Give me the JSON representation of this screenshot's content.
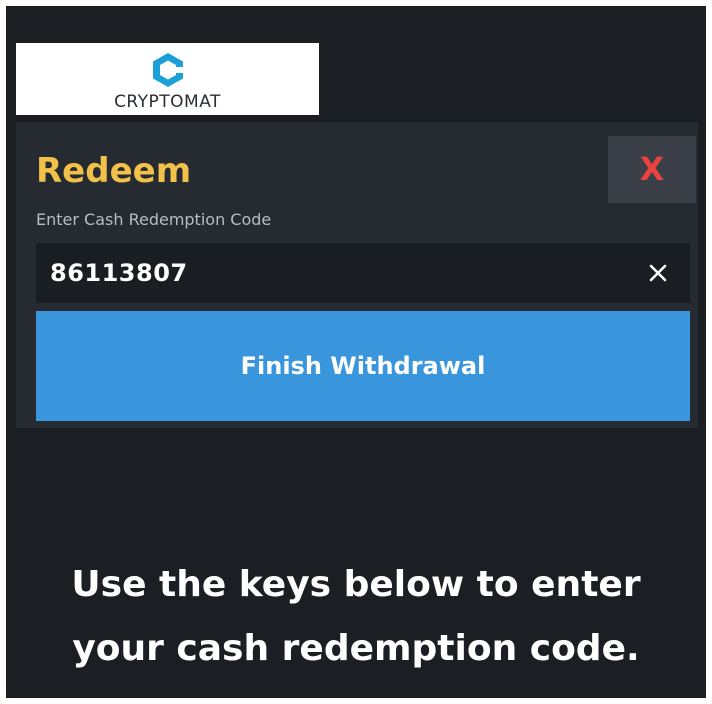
{
  "logo": {
    "name": "CRYPTOMAT",
    "icon": "cryptomat-c-logo",
    "color": "#1ba1d8"
  },
  "redeem_panel": {
    "title": "Redeem",
    "close_label": "X",
    "code_label": "Enter Cash Redemption Code",
    "code_value": "86113807",
    "clear_icon": "close-icon",
    "finish_label": "Finish Withdrawal"
  },
  "instructions": {
    "line1": "Use the keys below to enter",
    "line2": "your cash redemption code."
  },
  "colors": {
    "background": "#1b1e23",
    "panel": "#262a31",
    "title": "#f2c14a",
    "close": "#e8433e",
    "button": "#3a96dc"
  }
}
